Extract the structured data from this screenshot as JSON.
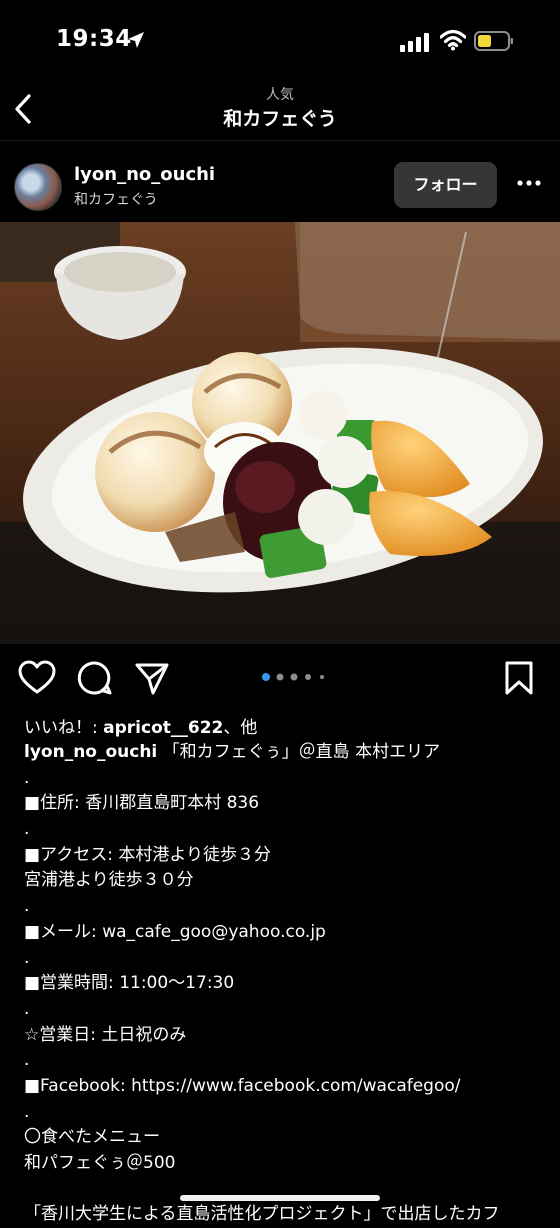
{
  "status_bar": {
    "time": "19:34"
  },
  "nav": {
    "subtitle": "人気",
    "title": "和カフェぐう"
  },
  "post": {
    "username": "lyon_no_ouchi",
    "location": "和カフェぐう",
    "follow_label": "フォロー",
    "carousel": {
      "count": 5,
      "active_index": 0
    }
  },
  "likes": {
    "prefix": "いいね！: ",
    "user": "apricot__622",
    "suffix": "、他"
  },
  "caption": {
    "username": "lyon_no_ouchi",
    "first_line": "「和カフェぐぅ」＠直島 本村エリア",
    "lines": [
      ".",
      "■住所: 香川郡直島町本村 836",
      ".",
      "■アクセス: 本村港より徒歩３分",
      "宮浦港より徒歩３０分",
      ".",
      "■メール: wa_cafe_goo@yahoo.co.jp",
      ".",
      "■営業時間: 11:00〜17:30",
      ".",
      "☆営業日: 土日祝のみ",
      ".",
      "■Facebook: https://www.facebook.com/wacafegoo/",
      ".",
      "〇食べたメニュー",
      "和パフェぐぅ＠500",
      "",
      "「香川大学生による直島活性化プロジェクト」で出店したカフ"
    ]
  },
  "colors": {
    "background": "#000000",
    "active_dot": "#3897f0",
    "follow_bg": "#363636",
    "battery": "#f2d83b"
  }
}
